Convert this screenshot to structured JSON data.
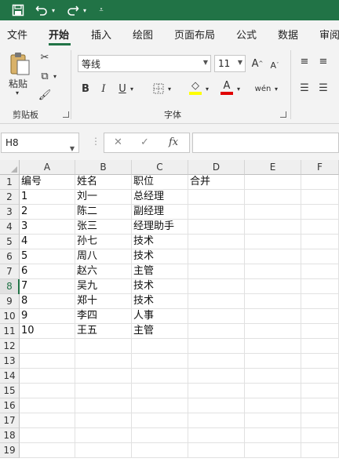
{
  "tabs": [
    "文件",
    "开始",
    "插入",
    "绘图",
    "页面布局",
    "公式",
    "数据",
    "审阅"
  ],
  "active_tab": "开始",
  "ribbon": {
    "clipboard": {
      "paste_label": "粘贴",
      "group_label": "剪贴板"
    },
    "font": {
      "font_name": "等线",
      "font_size": "11",
      "group_label": "字体"
    }
  },
  "formula_bar": {
    "name_box": "H8",
    "fx_label": "fx",
    "formula": ""
  },
  "columns": [
    "A",
    "B",
    "C",
    "D",
    "E",
    "F"
  ],
  "rows": [
    "1",
    "2",
    "3",
    "4",
    "5",
    "6",
    "7",
    "8",
    "9",
    "10",
    "11",
    "12",
    "13",
    "14",
    "15",
    "16",
    "17",
    "18",
    "19"
  ],
  "selected_row": "8",
  "cells": [
    [
      "编号",
      "姓名",
      "职位",
      "合并"
    ],
    [
      "1",
      "刘一",
      "总经理",
      ""
    ],
    [
      "2",
      "陈二",
      "副经理",
      ""
    ],
    [
      "3",
      "张三",
      "经理助手",
      ""
    ],
    [
      "4",
      "孙七",
      "技术",
      ""
    ],
    [
      "5",
      "周八",
      "技术",
      ""
    ],
    [
      "6",
      "赵六",
      "主管",
      ""
    ],
    [
      "7",
      "吴九",
      "技术",
      ""
    ],
    [
      "8",
      "郑十",
      "技术",
      ""
    ],
    [
      "9",
      "李四",
      "人事",
      ""
    ],
    [
      "10",
      "王五",
      "主管",
      ""
    ]
  ],
  "colors": {
    "accent": "#217346"
  },
  "icons": [
    "save-icon",
    "undo-icon",
    "redo-icon",
    "customize-qat-icon",
    "paste-icon",
    "cut-icon",
    "copy-icon",
    "format-painter-icon",
    "bold-icon",
    "italic-icon",
    "underline-icon",
    "border-icon",
    "fill-color-icon",
    "font-color-icon",
    "grow-font-icon",
    "shrink-font-icon",
    "phonetic-icon",
    "align-top-icon",
    "align-middle-icon",
    "align-left-icon",
    "align-center-icon"
  ]
}
